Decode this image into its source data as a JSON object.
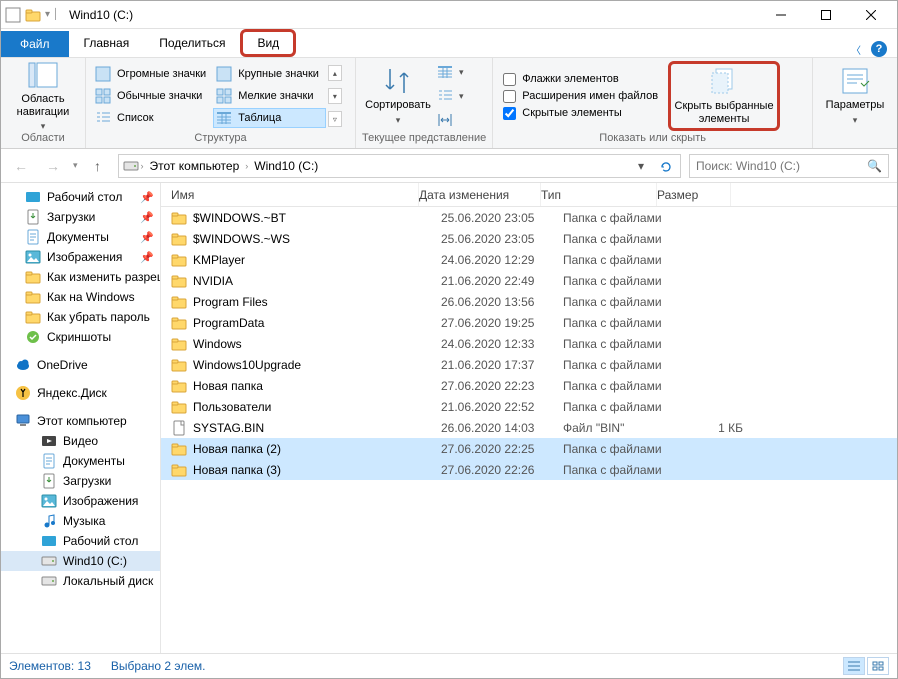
{
  "colors": {
    "accent": "#1979ca",
    "highlight": "#c63a2b",
    "selection": "#cde8ff"
  },
  "title": "Wind10 (C:)",
  "tabs": {
    "file": "Файл",
    "home": "Главная",
    "share": "Поделиться",
    "view": "Вид"
  },
  "ribbon": {
    "panes_btn": "Область\nнавигации",
    "panes_group": "Области",
    "layout": {
      "huge": "Огромные значки",
      "large": "Крупные значки",
      "medium": "Обычные значки",
      "small": "Мелкие значки",
      "list": "Список",
      "details": "Таблица",
      "group": "Структура"
    },
    "sort_btn": "Сортировать",
    "view_group": "Текущее представление",
    "chk_items": "Флажки элементов",
    "chk_ext": "Расширения имен файлов",
    "chk_hidden": "Скрытые элементы",
    "hide_btn": "Скрыть выбранные\nэлементы",
    "opts_btn": "Параметры",
    "show_group": "Показать или скрыть"
  },
  "breadcrumb": {
    "pc": "Этот компьютер",
    "drive": "Wind10 (C:)"
  },
  "search_placeholder": "Поиск: Wind10 (C:)",
  "columns": {
    "name": "Имя",
    "date": "Дата изменения",
    "type": "Тип",
    "size": "Размер"
  },
  "tree": {
    "desktop_q": "Рабочий стол",
    "downloads_q": "Загрузки",
    "documents_q": "Документы",
    "pictures_q": "Изображения",
    "howchg": "Как изменить разрешение",
    "howwin": "Как на Windows",
    "howclr": "Как убрать пароль",
    "screens": "Скриншоты",
    "onedrive": "OneDrive",
    "yadisk": "Яндекс.Диск",
    "thispc": "Этот компьютер",
    "videos": "Видео",
    "documents": "Документы",
    "downloads": "Загрузки",
    "pictures": "Изображения",
    "music": "Музыка",
    "desktop": "Рабочий стол",
    "drive": "Wind10 (C:)",
    "localdisk": "Локальный диск"
  },
  "rows": [
    {
      "name": "$WINDOWS.~BT",
      "date": "25.06.2020 23:05",
      "type": "Папка с файлами",
      "size": "",
      "icon": "folder",
      "sel": false
    },
    {
      "name": "$WINDOWS.~WS",
      "date": "25.06.2020 23:05",
      "type": "Папка с файлами",
      "size": "",
      "icon": "folder",
      "sel": false
    },
    {
      "name": "KMPlayer",
      "date": "24.06.2020 12:29",
      "type": "Папка с файлами",
      "size": "",
      "icon": "folder",
      "sel": false
    },
    {
      "name": "NVIDIA",
      "date": "21.06.2020 22:49",
      "type": "Папка с файлами",
      "size": "",
      "icon": "folder",
      "sel": false
    },
    {
      "name": "Program Files",
      "date": "26.06.2020 13:56",
      "type": "Папка с файлами",
      "size": "",
      "icon": "folder",
      "sel": false
    },
    {
      "name": "ProgramData",
      "date": "27.06.2020 19:25",
      "type": "Папка с файлами",
      "size": "",
      "icon": "folder",
      "sel": false
    },
    {
      "name": "Windows",
      "date": "24.06.2020 12:33",
      "type": "Папка с файлами",
      "size": "",
      "icon": "folder",
      "sel": false
    },
    {
      "name": "Windows10Upgrade",
      "date": "21.06.2020 17:37",
      "type": "Папка с файлами",
      "size": "",
      "icon": "folder",
      "sel": false
    },
    {
      "name": "Новая папка",
      "date": "27.06.2020 22:23",
      "type": "Папка с файлами",
      "size": "",
      "icon": "folder",
      "sel": false
    },
    {
      "name": "Пользователи",
      "date": "21.06.2020 22:52",
      "type": "Папка с файлами",
      "size": "",
      "icon": "folder",
      "sel": false
    },
    {
      "name": "SYSTAG.BIN",
      "date": "26.06.2020 14:03",
      "type": "Файл \"BIN\"",
      "size": "1 КБ",
      "icon": "file",
      "sel": false
    },
    {
      "name": "Новая папка (2)",
      "date": "27.06.2020 22:25",
      "type": "Папка с файлами",
      "size": "",
      "icon": "folder",
      "sel": true
    },
    {
      "name": "Новая папка (3)",
      "date": "27.06.2020 22:26",
      "type": "Папка с файлами",
      "size": "",
      "icon": "folder",
      "sel": true
    }
  ],
  "status": {
    "count": "Элементов: 13",
    "sel": "Выбрано 2 элем."
  }
}
